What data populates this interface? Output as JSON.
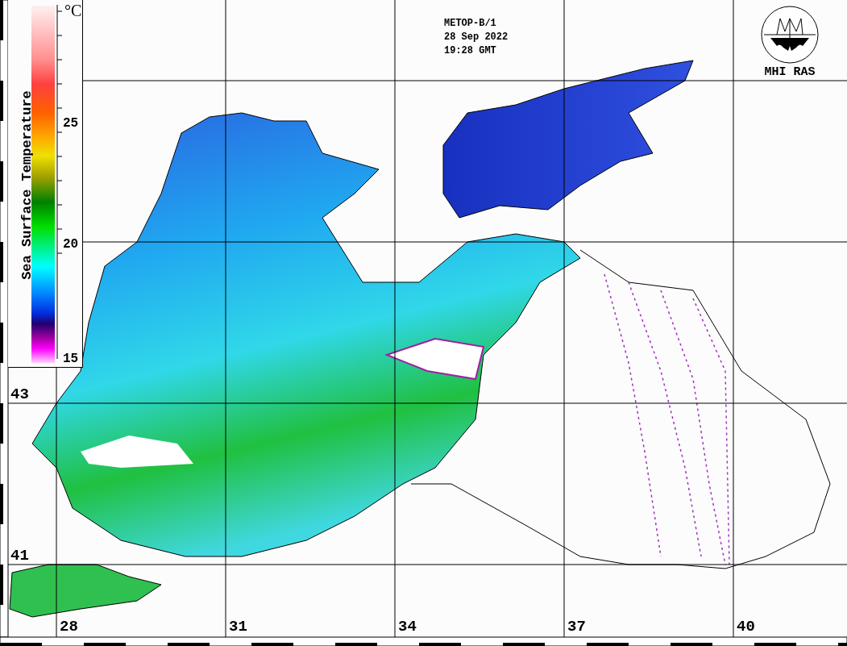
{
  "colorbar": {
    "title": "Sea Surface Temperature",
    "unit": "°C",
    "ticks": [
      {
        "label": "25"
      },
      {
        "label": "20"
      },
      {
        "label": "15"
      }
    ]
  },
  "header": {
    "lines": [
      "METOP-B/1",
      "28 Sep 2022",
      "19:28 GMT"
    ]
  },
  "logo": {
    "label": "MHI RAS"
  },
  "map": {
    "latitude_labels": [
      "43",
      "41"
    ],
    "longitude_labels": [
      "28",
      "31",
      "34",
      "37",
      "40"
    ]
  }
}
